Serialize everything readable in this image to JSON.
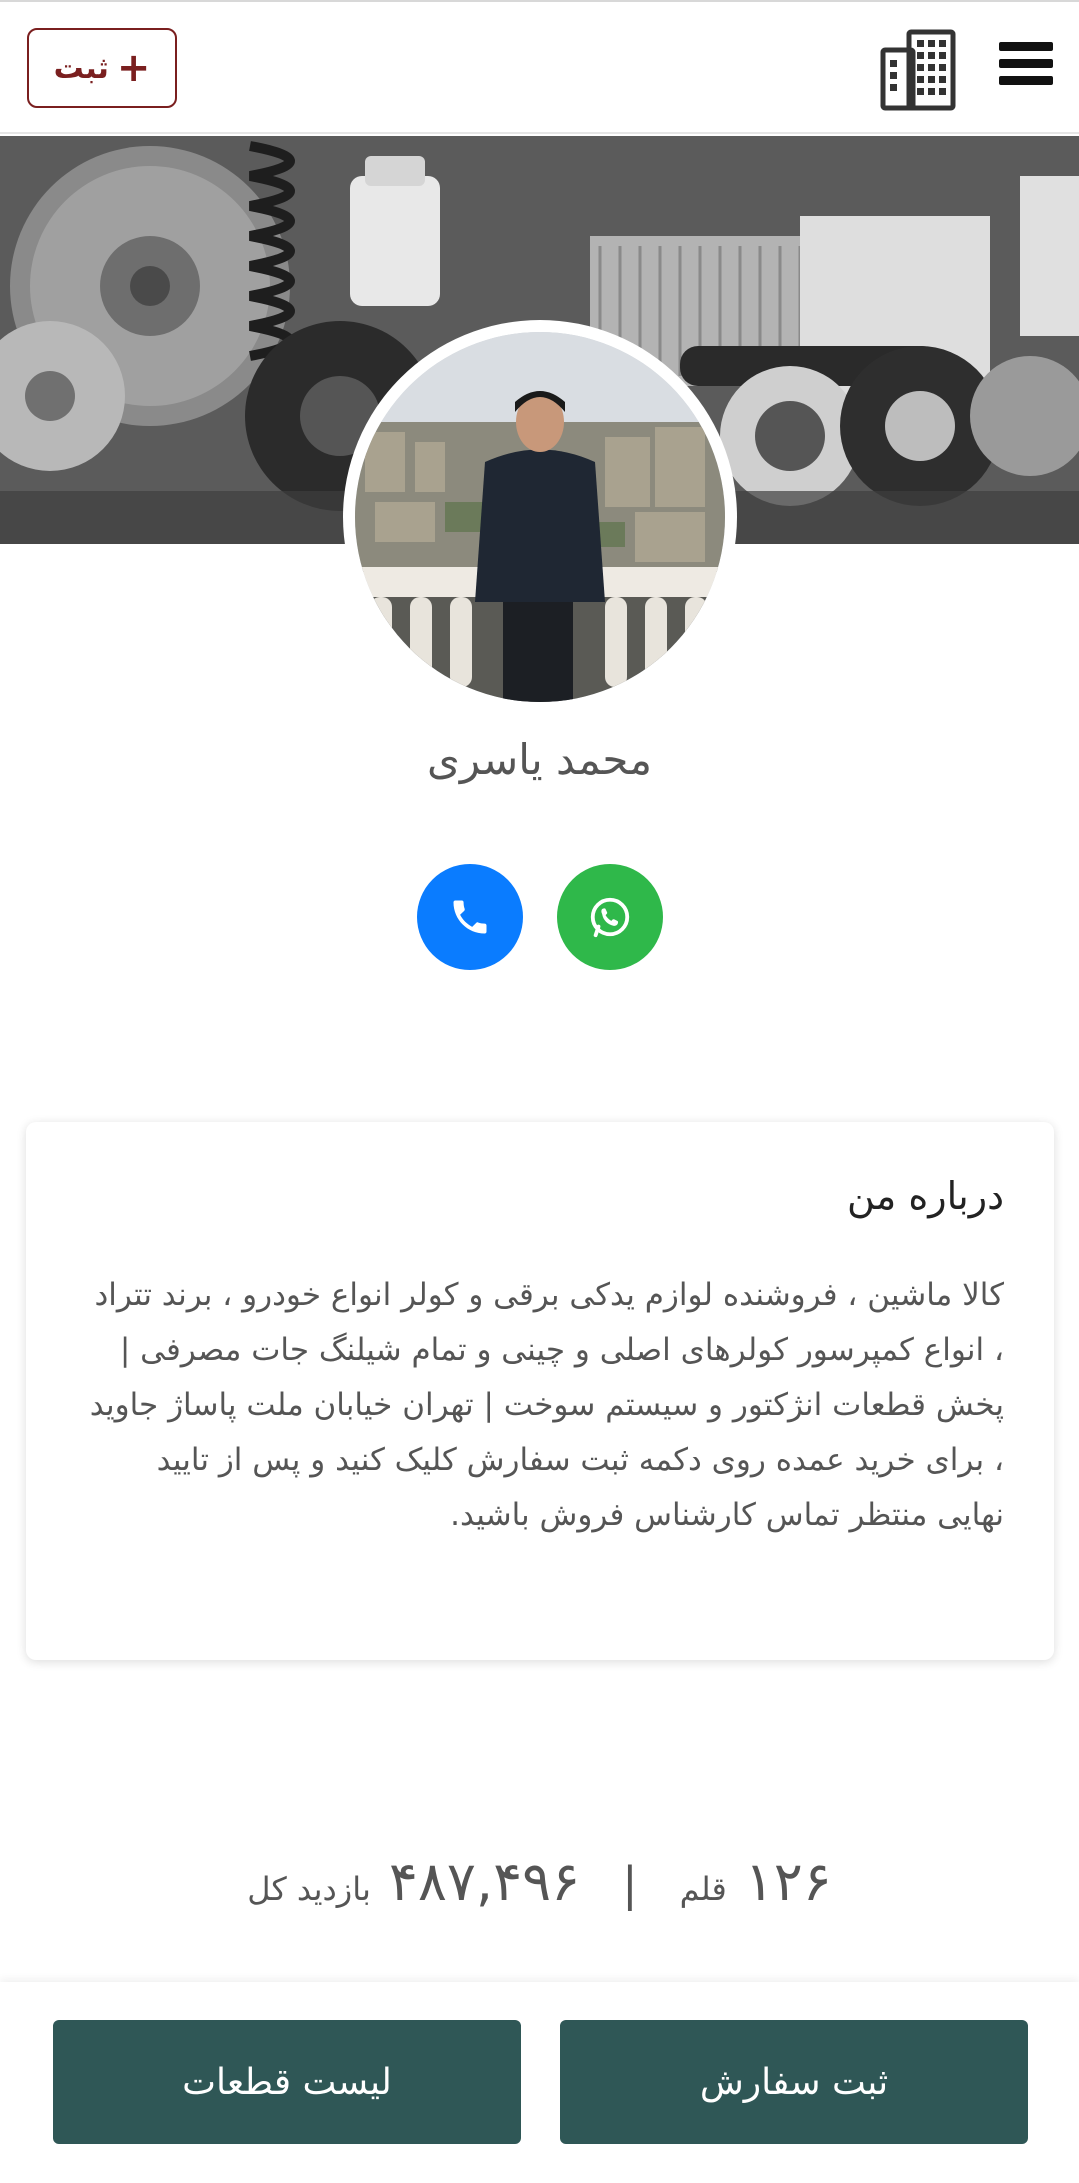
{
  "header": {
    "add_button_label": "ثبت",
    "menu_icon": "hamburger-menu-icon",
    "building_icon": "building-icon",
    "accent_color": "#7a1f1f"
  },
  "profile": {
    "name": "محمد یاسری",
    "contact_buttons": [
      {
        "icon": "phone-icon",
        "color": "#0a7cff"
      },
      {
        "icon": "whatsapp-icon",
        "color": "#2fb84a"
      }
    ]
  },
  "about": {
    "title": "درباره من",
    "text": "کالا ماشین ، فروشنده لوازم یدکی برقی و کولر انواع خودرو ، برند تتراد ، انواع کمپرسور کولرهای اصلی و چینی و تمام شیلنگ جات مصرفی | پخش قطعات انژکتور و سیستم سوخت | تهران خیابان ملت پاساژ جاوید ، برای خرید عمده روی دکمه ثبت سفارش کلیک کنید و پس از تایید نهایی منتظر تماس کارشناس فروش باشید."
  },
  "stats": {
    "items_count": "۱۲۶",
    "items_unit": "قلم",
    "separator": "|",
    "views_count": "۴۸۷,۴۹۶",
    "views_label": "بازدید کل"
  },
  "footer": {
    "order_label": "ثبت سفارش",
    "list_label": "لیست قطعات",
    "button_color": "#2f5756"
  }
}
